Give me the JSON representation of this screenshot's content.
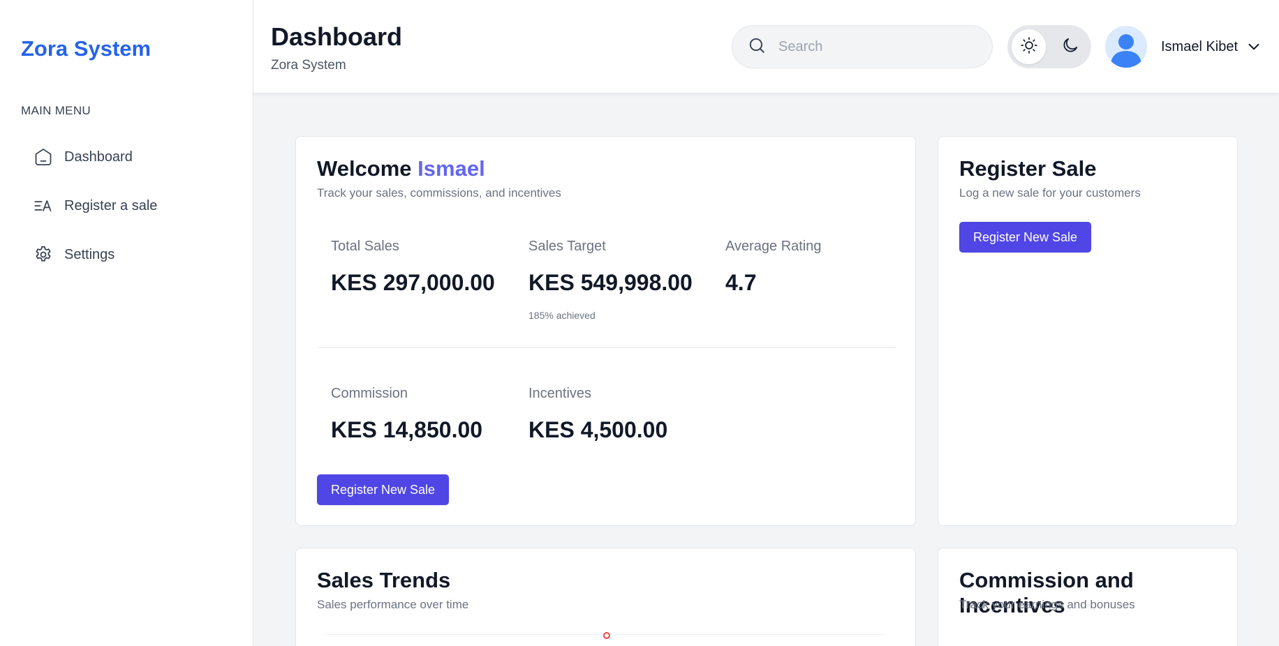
{
  "sidebar": {
    "brand": "Zora System",
    "menu_title": "MAIN MENU",
    "items": [
      {
        "label": "Dashboard",
        "icon": "home-icon"
      },
      {
        "label": "Register a sale",
        "icon": "translate-icon"
      },
      {
        "label": "Settings",
        "icon": "gear-icon"
      }
    ]
  },
  "header": {
    "title": "Dashboard",
    "subtitle": "Zora System",
    "search_placeholder": "Search",
    "user_name": "Ismael Kibet"
  },
  "welcome_card": {
    "title_prefix": "Welcome",
    "title_name": "Ismael",
    "subtitle": "Track your sales, commissions, and incentives",
    "stats": [
      {
        "label": "Total Sales",
        "value": "KES 297,000.00"
      },
      {
        "label": "Sales Target",
        "value": "KES 549,998.00",
        "note": "185% achieved"
      },
      {
        "label": "Average Rating",
        "value": "4.7"
      },
      {
        "label": "Commission",
        "value": "KES 14,850.00"
      },
      {
        "label": "Incentives",
        "value": "KES 4,500.00"
      }
    ],
    "button_label": "Register New Sale"
  },
  "register_card": {
    "title": "Register Sale",
    "subtitle": "Log a new sale for your customers",
    "button_label": "Register New Sale"
  },
  "trends_card": {
    "title": "Sales Trends",
    "subtitle": "Sales performance over time"
  },
  "commission_card": {
    "title": "Commission and Incentives",
    "subtitle": "Track your earnings and bonuses"
  },
  "colors": {
    "brand": "#2563eb",
    "accent": "#6366f1",
    "button": "#4f46e5"
  }
}
